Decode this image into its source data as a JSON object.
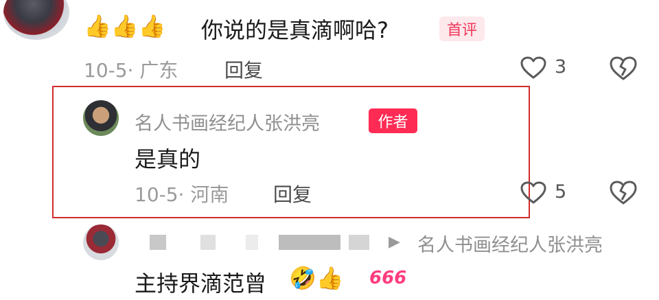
{
  "comments": [
    {
      "text_emoji": "👍👍👍",
      "text": "你说的是真滴啊哈?",
      "badge": "首评",
      "date_location": "10-5· 广东",
      "reply_label": "回复",
      "like_count": "3"
    },
    {
      "author": "名人书画经纪人张洪亮",
      "badge": "作者",
      "text": "是真的",
      "date_location": "10-5· 河南",
      "reply_label": "回复",
      "like_count": "5"
    },
    {
      "reply_to_arrow": "▶",
      "reply_to": "名人书画经纪人张洪亮",
      "text": "主持界滴范曾",
      "trailing_emoji": "🤣👍",
      "trailing_tag": "666"
    }
  ],
  "icons": {
    "like": "heart-outline-icon",
    "dislike": "broken-heart-icon",
    "reply_arrow": "play-arrow-icon"
  },
  "colors": {
    "accent": "#fe2c55",
    "first_badge_text": "#f2385a",
    "first_badge_bg": "#fde8ec",
    "highlight_border": "#d22a2a",
    "meta_text": "#9a9a9a"
  }
}
